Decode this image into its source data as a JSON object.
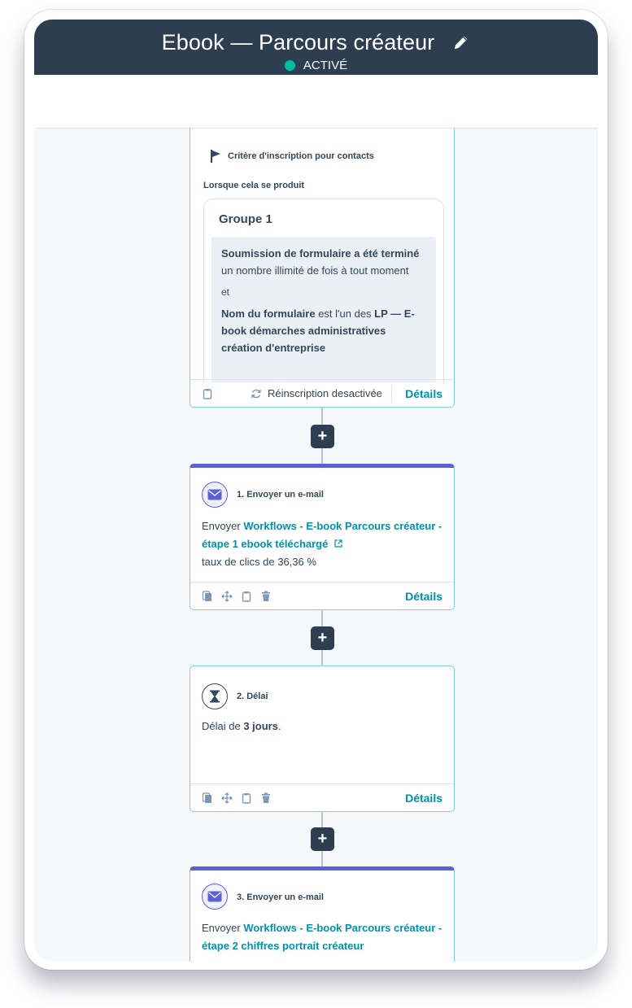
{
  "header": {
    "title": "Ebook — Parcours créateur",
    "status": "ACTIVÉ",
    "colors": {
      "bar": "#2d3e50",
      "status_dot": "#00bda5"
    }
  },
  "trigger_card": {
    "heading": "Critère d'inscription pour contacts",
    "when_label": "Lorsque cela se produit",
    "group_title": "Groupe 1",
    "condition1_bold": "Soumission de formulaire a été terminé",
    "condition1_text": " un nombre illimité de fois à tout moment",
    "and_label": "et",
    "condition2_bold": "Nom du formulaire",
    "condition2_text": " est l'un des ",
    "condition2_value": "LP — E-book démarches administratives création d'entreprise",
    "reenroll_label": "Réinscription desactivée",
    "details_label": "Détails"
  },
  "steps": [
    {
      "title": "1. Envoyer un e-mail",
      "prefix": "Envoyer ",
      "link": "Workflows - E-book Parcours créateur - étape 1 ebook téléchargé",
      "stat": "taux de clics de 36,36 %",
      "details_label": "Détails"
    },
    {
      "title": "2. Délai",
      "prefix": "Délai de ",
      "bold": "3 jours",
      "suffix": ".",
      "details_label": "Détails"
    },
    {
      "title": "3. Envoyer un e-mail",
      "prefix": "Envoyer ",
      "link": "Workflows - E-book Parcours créateur - étape 2 chiffres portrait créateur"
    }
  ],
  "add_button_label": "+",
  "accent_colors": {
    "action_border": "#5c62d6",
    "link": "#0091ae",
    "card_border": "#7fd1de"
  }
}
